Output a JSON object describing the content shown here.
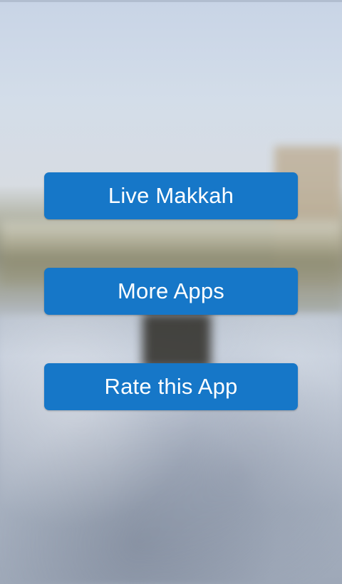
{
  "background": {
    "image": "blurred-mosque-crowd-photo"
  },
  "menu": {
    "live_makkah_label": "Live Makkah",
    "more_apps_label": "More Apps",
    "rate_app_label": "Rate this App"
  },
  "colors": {
    "button_bg": "#1677c8",
    "button_text": "#ffffff"
  }
}
